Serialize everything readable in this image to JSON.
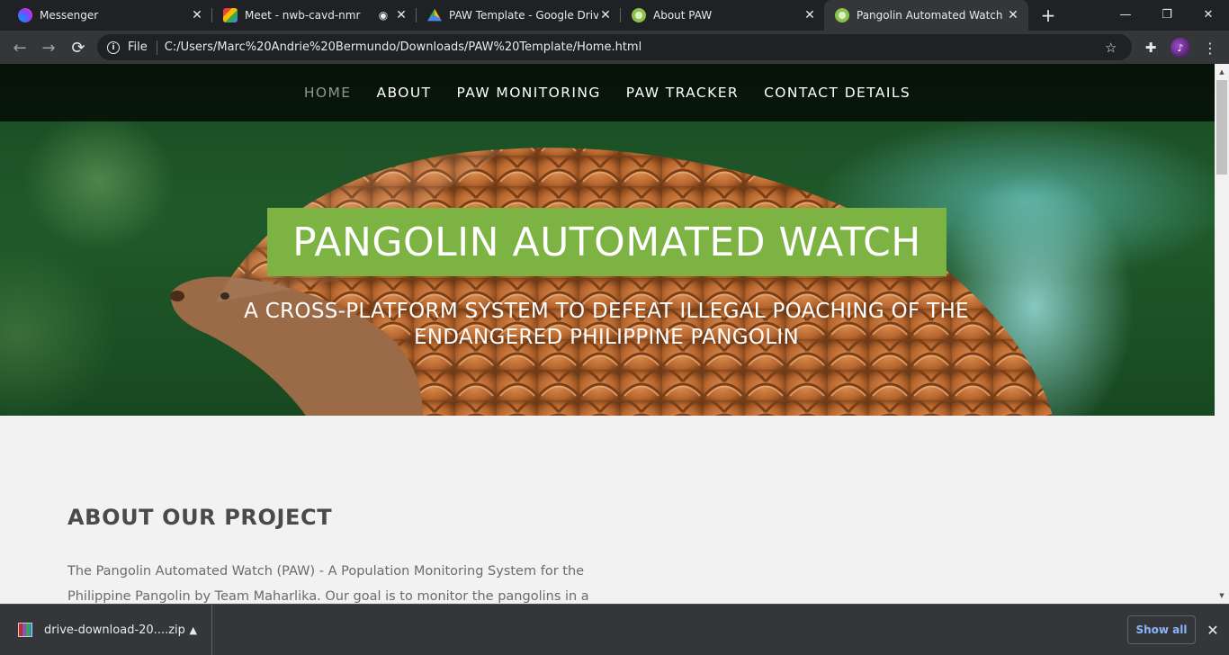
{
  "browser": {
    "tabs": [
      {
        "title": "Messenger",
        "icon": "messenger-icon",
        "color": "#a033ff"
      },
      {
        "title": "Meet - nwb-cavd-nmr",
        "icon": "google-meet-icon",
        "color": "#00897b"
      },
      {
        "title": "PAW Template - Google Drive",
        "icon": "google-drive-icon",
        "color": "#fbbc04"
      },
      {
        "title": "About PAW",
        "icon": "paw-site-icon",
        "color": "#9ccc65"
      },
      {
        "title": "Pangolin Automated Watch",
        "icon": "paw-site-icon",
        "color": "#9ccc65"
      }
    ],
    "active_tab": 4,
    "new_tab_symbol": "+",
    "window_controls": {
      "minimize": "—",
      "restore": "❐",
      "close": "✕"
    },
    "toolbar": {
      "back": "←",
      "forward": "→",
      "reload": "⟳",
      "file_label": "File",
      "url": "C:/Users/Marc%20Andrie%20Bermundo/Downloads/PAW%20Template/Home.html"
    }
  },
  "site": {
    "nav": [
      "HOME",
      "ABOUT",
      "PAW MONITORING",
      "PAW TRACKER",
      "CONTACT DETAILS"
    ],
    "current_nav": "HOME",
    "hero_title": "PANGOLIN AUTOMATED WATCH",
    "hero_subtitle_line1": "A CROSS-PLATFORM SYSTEM TO DEFEAT ILLEGAL POACHING OF THE",
    "hero_subtitle_line2": "ENDANGERED PHILIPPINE PANGOLIN",
    "about_title": "ABOUT OUR PROJECT",
    "about_line1": "The Pangolin Automated Watch (PAW) - A Population Monitoring System for the",
    "about_line2": "Philippine Pangolin by Team Maharlika. Our goal is to monitor the pangolins in a",
    "accent_color": "#7cb342"
  },
  "downloads": {
    "file_name": "drive-download-20....zip",
    "show_all": "Show all",
    "close": "✕"
  }
}
